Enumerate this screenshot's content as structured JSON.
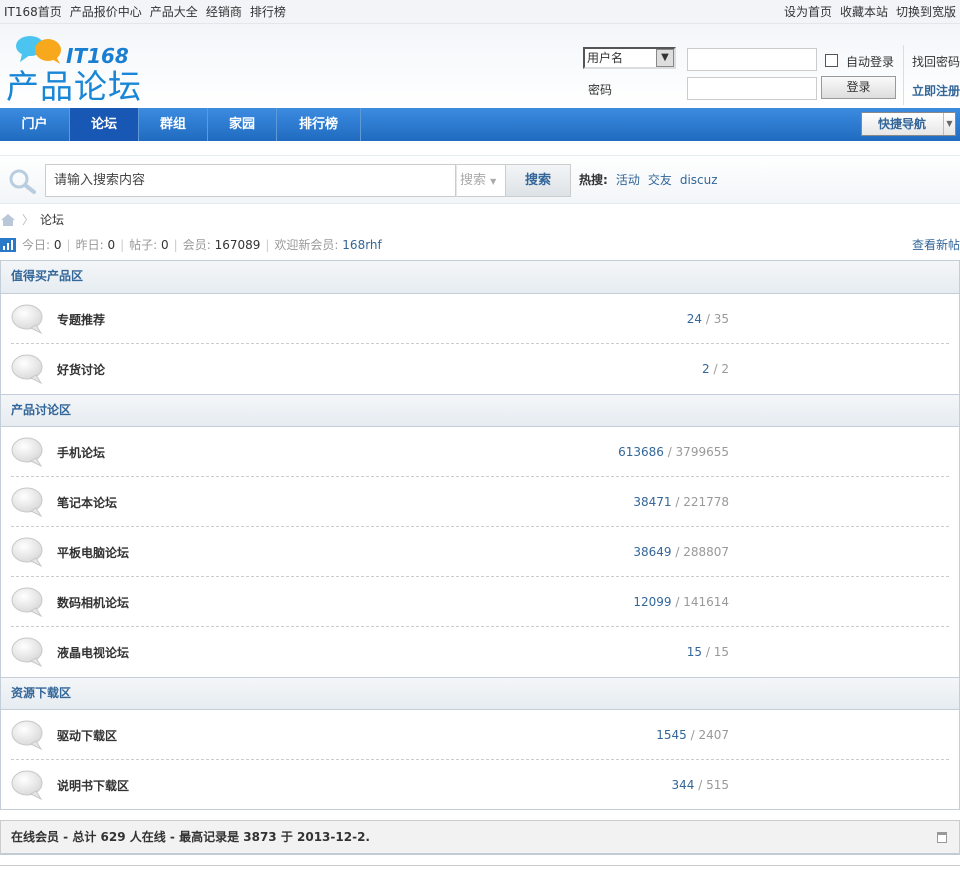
{
  "topbar": {
    "left": [
      "IT168首页",
      "产品报价中心",
      "产品大全",
      "经销商",
      "排行榜"
    ],
    "right": [
      "设为首页",
      "收藏本站",
      "切换到宽版"
    ]
  },
  "logo": {
    "it": "IT",
    "num": "168",
    "cn": "产品论坛"
  },
  "login": {
    "select": "用户名",
    "password_label": "密码",
    "auto_login": "自动登录",
    "login_button": "登录",
    "forgot": "找回密码",
    "register": "立即注册"
  },
  "nav": {
    "items": [
      "门户",
      "论坛",
      "群组",
      "家园",
      "排行榜"
    ],
    "quick": "快捷导航"
  },
  "search": {
    "placeholder": "请输入搜索内容",
    "type": "搜索",
    "button": "搜索",
    "hot_label": "热搜:",
    "hot": [
      "活动",
      "交友",
      "discuz"
    ]
  },
  "breadcrumb": {
    "current": "论坛"
  },
  "stats": {
    "today_label": "今日:",
    "today": "0",
    "yesterday_label": "昨日:",
    "yesterday": "0",
    "posts_label": "帖子:",
    "posts": "0",
    "members_label": "会员:",
    "members": "167089",
    "newmember_label": "欢迎新会员:",
    "newmember": "168rhf",
    "new_posts": "查看新帖"
  },
  "categories": [
    {
      "name": "值得买产品区",
      "forums": [
        {
          "name": "专题推荐",
          "threads": "24",
          "posts": "35"
        },
        {
          "name": "好货讨论",
          "threads": "2",
          "posts": "2"
        }
      ]
    },
    {
      "name": "产品讨论区",
      "forums": [
        {
          "name": "手机论坛",
          "threads": "613686",
          "posts": "3799655"
        },
        {
          "name": "笔记本论坛",
          "threads": "38471",
          "posts": "221778"
        },
        {
          "name": "平板电脑论坛",
          "threads": "38649",
          "posts": "288807"
        },
        {
          "name": "数码相机论坛",
          "threads": "12099",
          "posts": "141614"
        },
        {
          "name": "液晶电视论坛",
          "threads": "15",
          "posts": "15"
        }
      ]
    },
    {
      "name": "资源下载区",
      "forums": [
        {
          "name": "驱动下载区",
          "threads": "1545",
          "posts": "2407"
        },
        {
          "name": "说明书下载区",
          "threads": "344",
          "posts": "515"
        }
      ]
    }
  ],
  "online": {
    "text": "在线会员 - 总计 629 人在线 - 最高记录是 3873 于 2013-12-2."
  }
}
